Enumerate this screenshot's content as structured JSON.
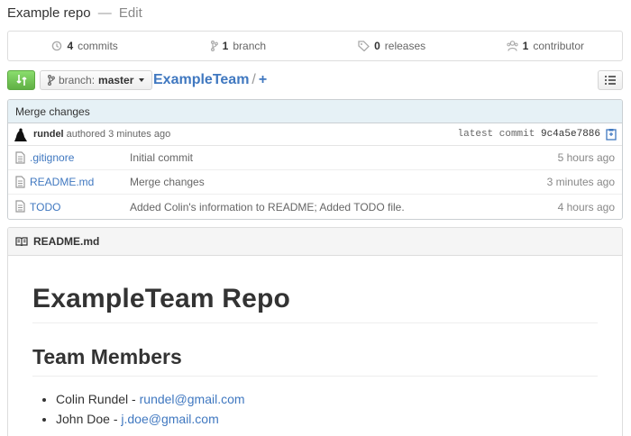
{
  "repo": {
    "name": "Example repo",
    "separator": "—",
    "edit_label": "Edit"
  },
  "stats": {
    "commits_count": "4",
    "commits_label": "commits",
    "branches_count": "1",
    "branches_label": "branch",
    "releases_count": "0",
    "releases_label": "releases",
    "contributors_count": "1",
    "contributors_label": "contributor"
  },
  "toolbar": {
    "branch_prefix": "branch:",
    "branch_name": "master",
    "breadcrumb_repo": "ExampleTeam",
    "breadcrumb_sep": "/",
    "breadcrumb_add": "+"
  },
  "commit": {
    "message": "Merge changes",
    "author": "rundel",
    "authored_text": "authored 3 minutes ago",
    "latest_label": "latest commit",
    "sha": "9c4a5e7886"
  },
  "files": [
    {
      "name": ".gitignore",
      "message": "Initial commit",
      "age": "5 hours ago"
    },
    {
      "name": "README.md",
      "message": "Merge changes",
      "age": "3 minutes ago"
    },
    {
      "name": "TODO",
      "message": "Added Colin's information to README; Added TODO file.",
      "age": "4 hours ago"
    }
  ],
  "readme": {
    "header": "README.md",
    "title": "ExampleTeam Repo",
    "section": "Team Members",
    "members": [
      {
        "name": "Colin Rundel",
        "sep": " - ",
        "email": "rundel@gmail.com"
      },
      {
        "name": "John Doe",
        "sep": " - ",
        "email": "j.doe@gmail.com"
      }
    ]
  },
  "colors": {
    "link": "#4078c0",
    "compare_green": "#60b044",
    "commit_bar": "#e6f1f6"
  }
}
